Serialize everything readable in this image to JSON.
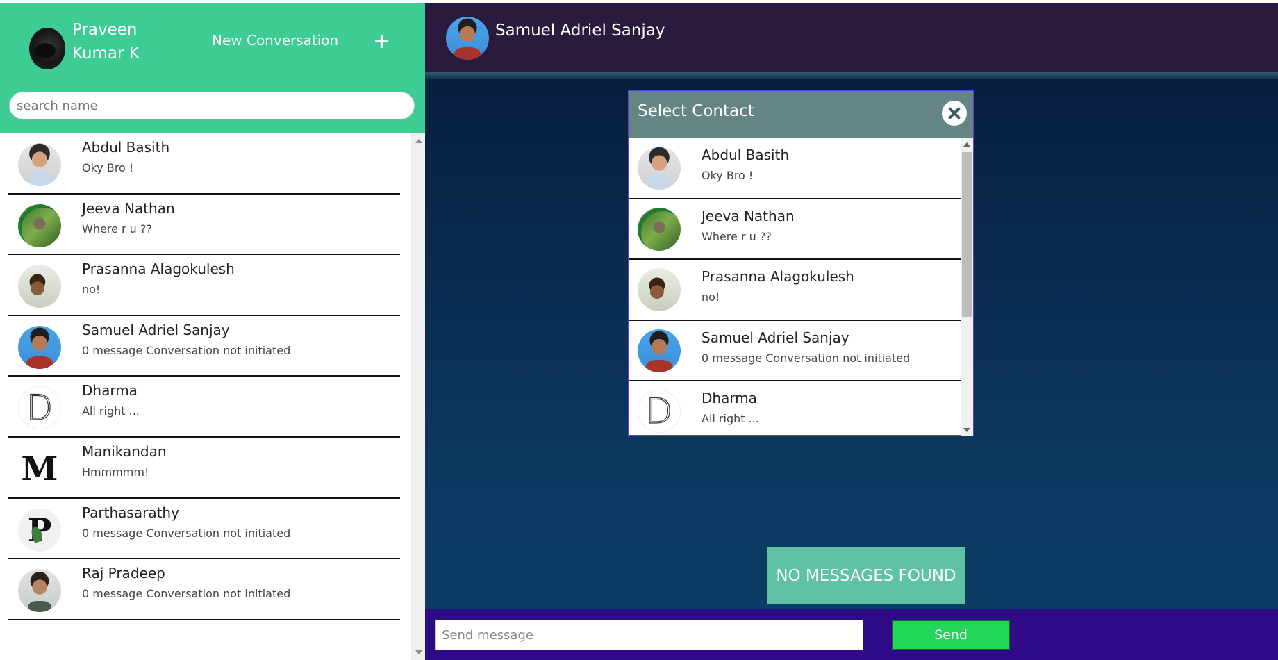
{
  "user": {
    "name": "Praveen Kumar K",
    "avatar_icon": "user-avatar"
  },
  "sidebar": {
    "new_conversation_label": "New Conversation",
    "add_icon": "+",
    "search": {
      "placeholder": "search name",
      "value": ""
    },
    "contacts": [
      {
        "name": "Abdul Basith",
        "message": "Oky Bro !"
      },
      {
        "name": "Jeeva Nathan",
        "message": "Where r u ??"
      },
      {
        "name": "Prasanna Alagokulesh",
        "message": "no!"
      },
      {
        "name": "Samuel Adriel Sanjay",
        "message": "0 message Conversation not initiated"
      },
      {
        "name": "Dharma",
        "message": "All right ...",
        "letter": "D"
      },
      {
        "name": "Manikandan",
        "message": "Hmmmmm!",
        "letter": "M"
      },
      {
        "name": "Parthasarathy",
        "message": "0 message Conversation not initiated",
        "letter": "P"
      },
      {
        "name": "Raj Pradeep",
        "message": "0 message Conversation not initiated"
      }
    ]
  },
  "chat": {
    "title": "Samuel Adriel Sanjay",
    "empty_state": "NO MESSAGES FOUND",
    "composer": {
      "placeholder": "Send message",
      "value": "",
      "send_label": "Send"
    }
  },
  "modal": {
    "title": "Select Contact",
    "contacts": [
      {
        "name": "Abdul Basith",
        "message": "Oky Bro !"
      },
      {
        "name": "Jeeva Nathan",
        "message": "Where r u ??"
      },
      {
        "name": "Prasanna Alagokulesh",
        "message": "no!"
      },
      {
        "name": "Samuel Adriel Sanjay",
        "message": "0 message Conversation not initiated"
      },
      {
        "name": "Dharma",
        "message": "All right ...",
        "letter": "D"
      }
    ]
  },
  "colors": {
    "sidebar_header": "#3ecc95",
    "chat_header": "#2a1a3e",
    "modal_header": "#658484",
    "send_button": "#22d65a",
    "composer_bar": "#2e0a86",
    "empty_state_bg": "#5fc2a7"
  }
}
